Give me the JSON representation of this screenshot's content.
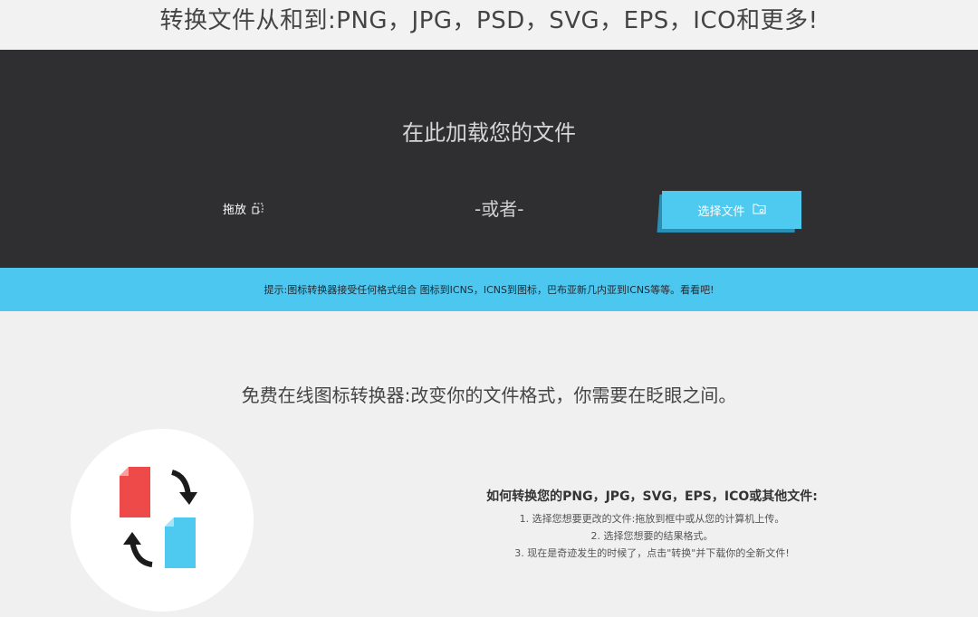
{
  "header": {
    "title": "转换文件从和到:PNG，JPG，PSD，SVG，EPS，ICO和更多!"
  },
  "upload": {
    "heading": "在此加载您的文件",
    "drag_label": "拖放",
    "or_label": "-或者-",
    "choose_label": "选择文件"
  },
  "tip": {
    "text": "提示:图标转换器接受任何格式组合 图标到ICNS，ICNS到图标，巴布亚新几内亚到ICNS等等。看看吧!"
  },
  "content": {
    "tagline": "免费在线图标转换器:改变你的文件格式，你需要在眨眼之间。",
    "howto_title": "如何转换您的PNG，JPG，SVG，EPS，ICO或其他文件:",
    "steps": [
      "1. 选择您想要更改的文件:拖放到框中或从您的计算机上传。",
      "2. 选择您想要的结果格式。",
      "3. 现在是奇迹发生的时候了，点击\"转换\"并下载你的全新文件!"
    ]
  },
  "colors": {
    "accent": "#4cc7ef",
    "dark_panel": "#2f2e30",
    "icon_red": "#ee4a4a",
    "icon_blue": "#4ec9ef"
  },
  "icons": [
    "drag-drop-icon",
    "folder-icon",
    "convert-illustration-icon"
  ]
}
